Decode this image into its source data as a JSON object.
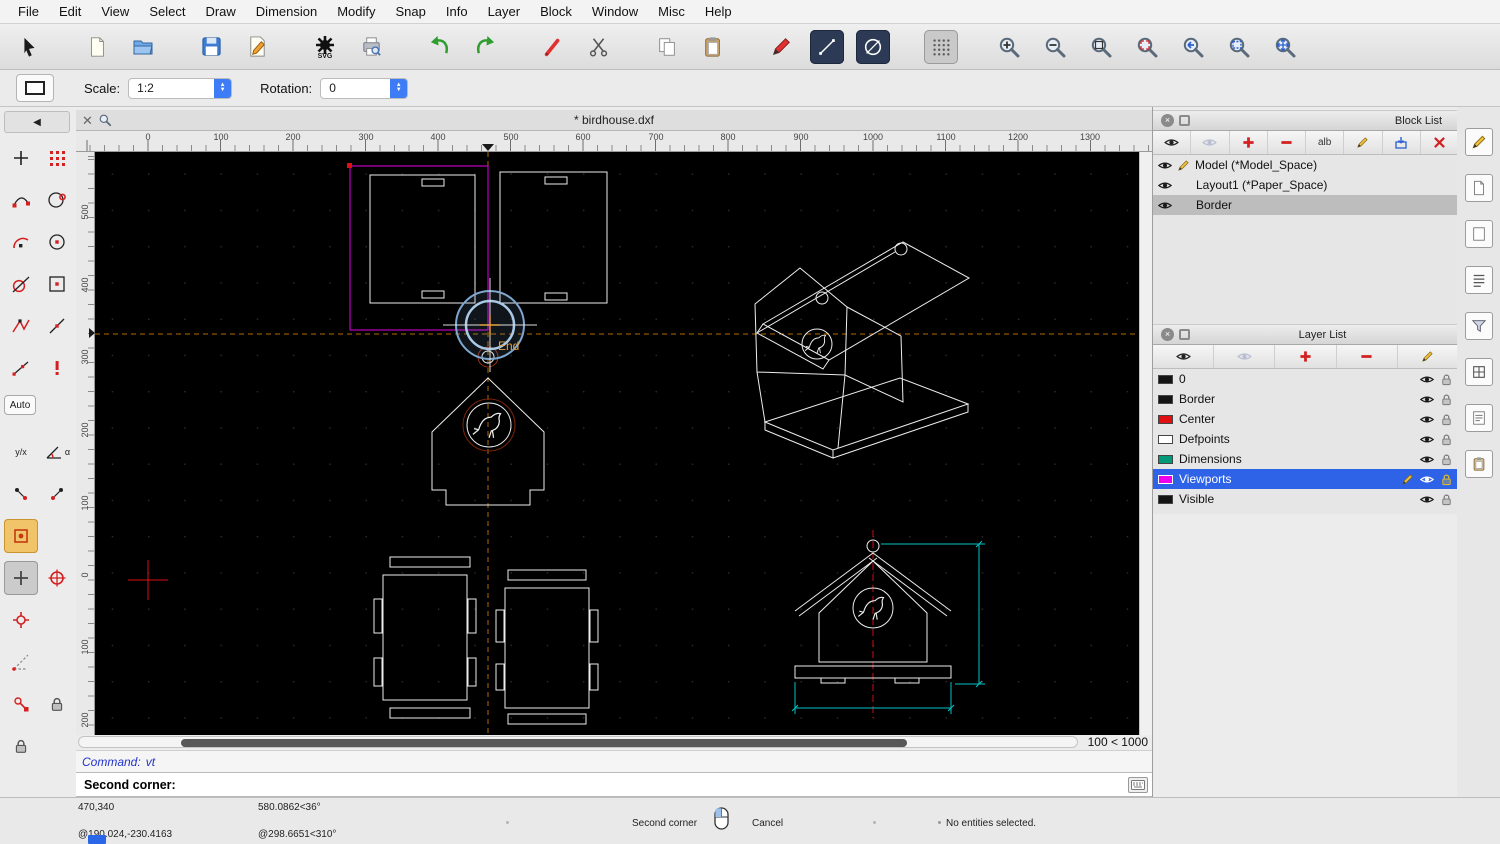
{
  "menu": {
    "items": [
      "File",
      "Edit",
      "View",
      "Select",
      "Draw",
      "Dimension",
      "Modify",
      "Snap",
      "Info",
      "Layer",
      "Block",
      "Window",
      "Misc",
      "Help"
    ]
  },
  "toolbar": {
    "svg_label": "SVG"
  },
  "options": {
    "scale_label": "Scale:",
    "scale_value": "1:2",
    "rotation_label": "Rotation:",
    "rotation_value": "0"
  },
  "doc": {
    "title": "* birdhouse.dxf"
  },
  "ruler": {
    "h": [
      "0",
      "100",
      "200",
      "300",
      "400",
      "500",
      "600",
      "700",
      "800",
      "900",
      "1000",
      "1100",
      "1200",
      "1300"
    ],
    "v": [
      "500",
      "400",
      "300",
      "200",
      "100",
      "0",
      "100",
      "200"
    ]
  },
  "canvas": {
    "snap_label": "End",
    "grid_status": "100 < 1000"
  },
  "command": {
    "history_label": "Command:",
    "history_value": "vt",
    "prompt": "Second corner:"
  },
  "status": {
    "coord_abs": "470,340",
    "coord_rel": "@190.024,-230.4163",
    "polar_abs": "580.0862<36°",
    "polar_rel": "@298.6651<310°",
    "action": "Second corner",
    "cancel": "Cancel",
    "selection": "No entities selected."
  },
  "blocks": {
    "title": "Block List",
    "rename_label": "alb",
    "items": [
      {
        "label": "Model (*Model_Space)"
      },
      {
        "label": "Layout1 (*Paper_Space)"
      },
      {
        "label": "Border"
      }
    ]
  },
  "layers": {
    "title": "Layer List",
    "items": [
      {
        "name": "0",
        "color": "#141414"
      },
      {
        "name": "Border",
        "color": "#141414"
      },
      {
        "name": "Center",
        "color": "#e01010"
      },
      {
        "name": "Defpoints",
        "color": "#ffffff"
      },
      {
        "name": "Dimensions",
        "color": "#009a78"
      },
      {
        "name": "Viewports",
        "color": "#ee00ee"
      },
      {
        "name": "Visible",
        "color": "#141414"
      }
    ]
  },
  "left_toolbar": {
    "back_label": "◀",
    "auto_label": "Auto",
    "yx_label": "y/x",
    "alpha_label": "α"
  }
}
